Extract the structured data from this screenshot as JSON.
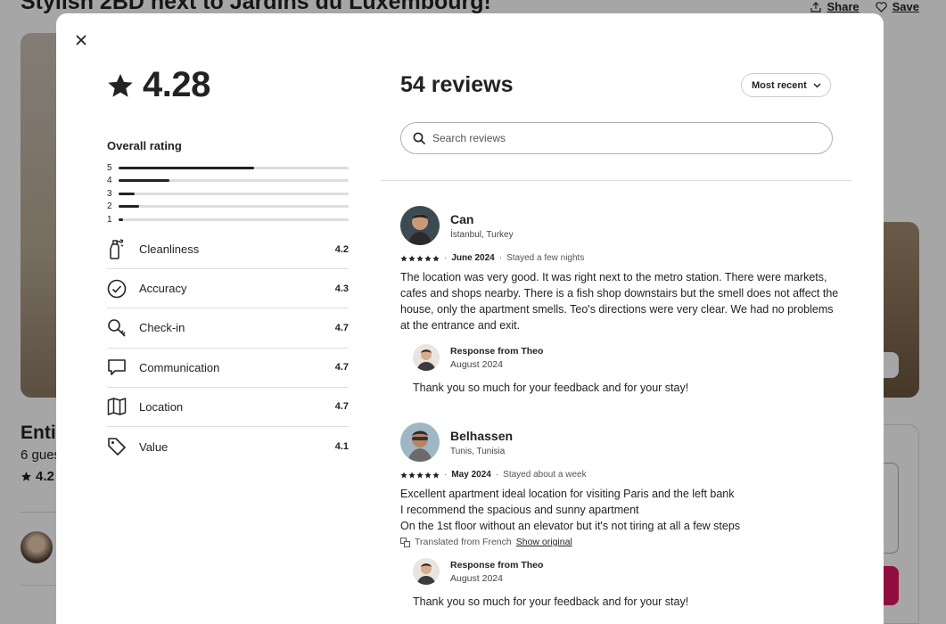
{
  "background": {
    "title": "Stylish 2BD next to Jardins du Luxembourg!",
    "share_label": "Share",
    "save_label": "Save",
    "heading_fragment": "Entir",
    "guests_fragment": "6 gues",
    "rating_fragment": "4.2"
  },
  "modal": {
    "overall_score": "4.28",
    "overall_label": "Overall rating",
    "distribution": [
      {
        "label": "5",
        "fraction": 0.59
      },
      {
        "label": "4",
        "fraction": 0.22
      },
      {
        "label": "3",
        "fraction": 0.07
      },
      {
        "label": "2",
        "fraction": 0.09
      },
      {
        "label": "1",
        "fraction": 0.02
      }
    ],
    "categories": [
      {
        "name": "Cleanliness",
        "value": "4.2",
        "icon": "spray-bottle-icon"
      },
      {
        "name": "Accuracy",
        "value": "4.3",
        "icon": "check-circle-icon"
      },
      {
        "name": "Check-in",
        "value": "4.7",
        "icon": "key-icon"
      },
      {
        "name": "Communication",
        "value": "4.7",
        "icon": "chat-bubble-icon"
      },
      {
        "name": "Location",
        "value": "4.7",
        "icon": "map-icon"
      },
      {
        "name": "Value",
        "value": "4.1",
        "icon": "tag-icon"
      }
    ],
    "reviews_count": "54 reviews",
    "sort_label": "Most recent",
    "search_placeholder": "Search reviews",
    "reviews": [
      {
        "name": "Can",
        "location": "İstanbul, Turkey",
        "date": "June 2024",
        "stay": "Stayed a few nights",
        "text": "The location was very good. It was right next to the metro station. There were markets, cafes and shops nearby. There is a fish shop downstairs but the smell does not affect the house, only the apartment smells. Teo's directions were very clear. We had no problems at the entrance and exit.",
        "response_from": "Response from Theo",
        "response_date": "August 2024",
        "response_text": "Thank you so much for your feedback and for your stay!"
      },
      {
        "name": "Belhassen",
        "location": "Tunis, Tunisia",
        "date": "May 2024",
        "stay": "Stayed about a week",
        "text_lines": [
          "Excellent apartment ideal location for visiting Paris and the left bank",
          "I recommend the spacious and sunny apartment",
          "On the 1st floor without an elevator but it's not tiring at all a few steps"
        ],
        "translated_label": "Translated from French",
        "show_original_label": "Show original",
        "response_from": "Response from Theo",
        "response_date": "August 2024",
        "response_text": "Thank you so much for your feedback and for your stay!"
      }
    ]
  }
}
